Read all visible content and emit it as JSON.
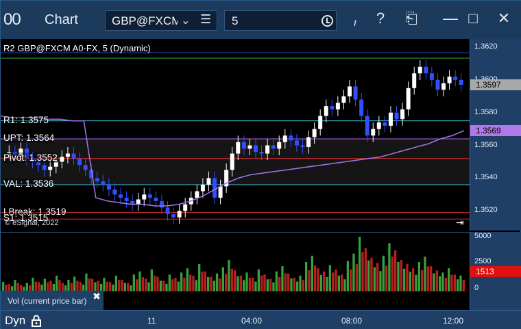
{
  "titlebar": {
    "logo": "00",
    "title": "Chart",
    "symbol": "GBP@FXCM",
    "interval": "5",
    "link_glyph": "ı",
    "help": "?",
    "template": "⎗",
    "minimize": "—",
    "maximize": "□",
    "close": "✕"
  },
  "price_panel": {
    "study_label": "R2 GBP@FXCM A0-FX, 5 (Dynamic)",
    "levels": [
      {
        "label": "R1: 1.3575",
        "price": 1.3575,
        "color": "#3cc8e8"
      },
      {
        "label": "UPT: 1.3564",
        "price": 1.3564,
        "color": "#b068e8"
      },
      {
        "label": "Pivot: 1.3552",
        "price": 1.3552,
        "color": "#e83030"
      },
      {
        "label": "VAL: 1.3536",
        "price": 1.3536,
        "color": "#3cc8e8"
      },
      {
        "label": "LBreak: 1.3519",
        "price": 1.3519,
        "color": "#e83030"
      },
      {
        "label": "S1: 1.3515",
        "price": 1.3515,
        "color": "#e83030"
      }
    ],
    "copyright": "© eSignal, 2022",
    "last_price": "1.3597",
    "ma_price": "1.3569"
  },
  "price_axis": {
    "ticks": [
      "1.3620",
      "1.3600",
      "1.3580",
      "1.3560",
      "1.3540",
      "1.3520"
    ]
  },
  "volume_panel": {
    "name": "Vol (current price bar)",
    "ticks": [
      "5000",
      "2500",
      "0"
    ],
    "last_volume": "1513"
  },
  "time_axis": {
    "dyn": "Dyn",
    "labels": [
      "11",
      "04:00",
      "08:00",
      "12:00"
    ]
  },
  "colors": {
    "up_bar": "#ffffff",
    "down_bar": "#3050ff",
    "vol_up": "#3aa03a",
    "vol_down": "#b82020",
    "ma": "#a070e0",
    "last_price_tag": "#a8a8a8",
    "ma_tag": "#b078e8",
    "vol_tag": "#e01010"
  },
  "chart_data": {
    "type": "candlestick",
    "ylim": [
      1.3508,
      1.3625
    ],
    "price": [
      1.3556,
      1.3554,
      1.3558,
      1.3552,
      1.355,
      1.3548,
      1.3545,
      1.3547,
      1.355,
      1.3553,
      1.3555,
      1.3552,
      1.3548,
      1.3545,
      1.354,
      1.3538,
      1.3536,
      1.3533,
      1.353,
      1.3528,
      1.3526,
      1.3524,
      1.3527,
      1.353,
      1.3528,
      1.3526,
      1.3522,
      1.3518,
      1.3516,
      1.352,
      1.3524,
      1.3528,
      1.3532,
      1.3536,
      1.354,
      1.3528,
      1.3535,
      1.3545,
      1.3555,
      1.3562,
      1.3558,
      1.356,
      1.3556,
      1.3555,
      1.356,
      1.3558,
      1.3562,
      1.3566,
      1.3563,
      1.356,
      1.3559,
      1.3565,
      1.357,
      1.3578,
      1.3584,
      1.3582,
      1.3586,
      1.359,
      1.3596,
      1.3588,
      1.3578,
      1.3566,
      1.357,
      1.3574,
      1.3572,
      1.358,
      1.3576,
      1.3582,
      1.3595,
      1.3604,
      1.3608,
      1.3604,
      1.36,
      1.3594,
      1.3598,
      1.3602,
      1.36,
      1.3597
    ],
    "ma": [
      1.3578,
      1.3577,
      1.3577,
      1.3577,
      1.3576,
      1.3576,
      1.3575,
      1.3575,
      1.3528,
      1.3526,
      1.3525,
      1.3524,
      1.3524,
      1.3523,
      1.3523,
      1.3524,
      1.3526,
      1.3529,
      1.3533,
      1.3537,
      1.354,
      1.3542,
      1.3543,
      1.3544,
      1.3545,
      1.3546,
      1.3547,
      1.3548,
      1.3549,
      1.355,
      1.3551,
      1.3552,
      1.3553,
      1.3555,
      1.3557,
      1.3559,
      1.3561,
      1.3564,
      1.3566,
      1.3569
    ],
    "volume": [
      900,
      700,
      1100,
      600,
      800,
      1300,
      900,
      1200,
      1000,
      1500,
      800,
      1100,
      1400,
      900,
      1700,
      1200,
      1000,
      1300,
      900,
      1500,
      1100,
      800,
      1600,
      1900,
      1200,
      2100,
      1400,
      1000,
      1600,
      1300,
      1800,
      2200,
      1500,
      2600,
      1900,
      1400,
      1700,
      2300,
      3000,
      2000,
      1500,
      1800,
      1300,
      2100,
      1600,
      1200,
      1900,
      2400,
      1700,
      1300,
      1500,
      2800,
      3400,
      2200,
      1900,
      2500,
      2100,
      1600,
      2900,
      3600,
      5200,
      4100,
      3200,
      2700,
      3400,
      4600,
      3900,
      3000,
      2600,
      2200,
      2800,
      3300,
      2400,
      2000,
      1800,
      2200,
      1600,
      1513
    ],
    "time_labels": [
      "11",
      "04:00",
      "08:00",
      "12:00"
    ]
  }
}
